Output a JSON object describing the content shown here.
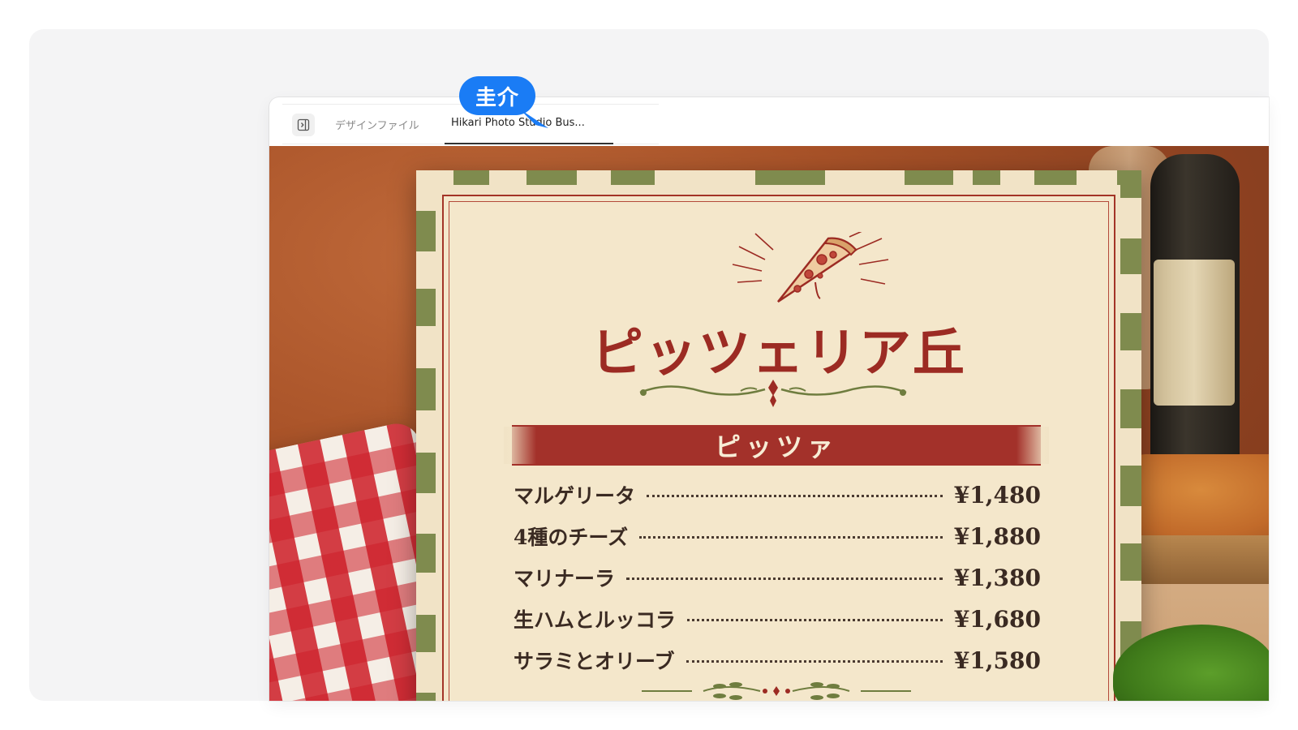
{
  "tabs": [
    {
      "label": "デザインファイル",
      "active": false
    },
    {
      "label": "Hikari Photo Studio Bus...",
      "active": true
    }
  ],
  "cursor": {
    "name": "圭介",
    "color": "#1a7cf5"
  },
  "menu": {
    "title": "ピッツェリア丘",
    "section": "ピッツァ",
    "items": [
      {
        "name": "マルゲリータ",
        "price": "¥1,480"
      },
      {
        "name": "4種のチーズ",
        "price": "¥1,880"
      },
      {
        "name": "マリナーラ",
        "price": "¥1,380"
      },
      {
        "name": "生ハムとルッコラ",
        "price": "¥1,680"
      },
      {
        "name": "サラミとオリーブ",
        "price": "¥1,580"
      }
    ],
    "colors": {
      "accent": "#a3312a",
      "paper": "#f1e3c6",
      "stripe": "#7f8b4e"
    }
  },
  "icons": {
    "panel_toggle": "sidebar-toggle-icon"
  }
}
